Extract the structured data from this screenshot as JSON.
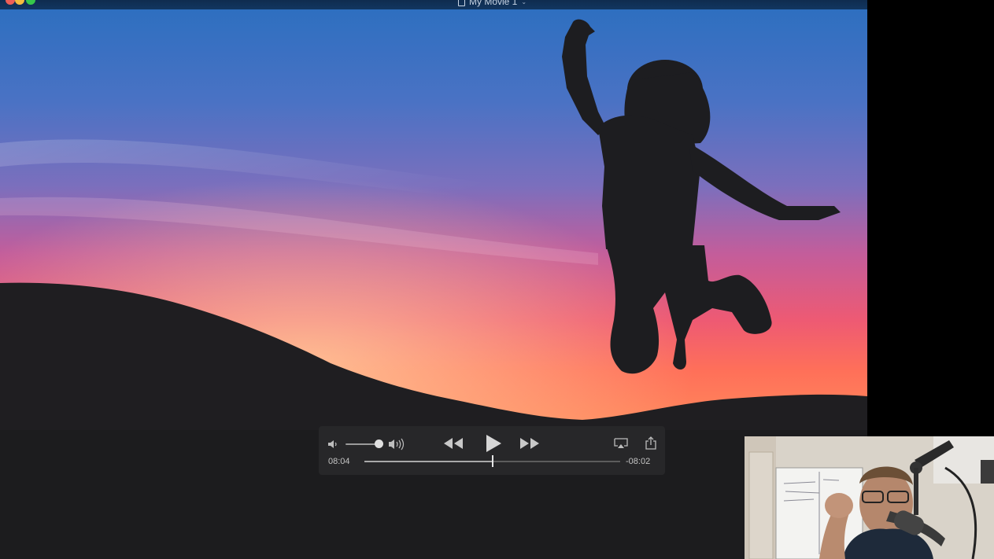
{
  "window": {
    "title": "My Movie 1",
    "traffic_colors": {
      "close": "#ee5f57",
      "minimize": "#f5bd3f",
      "zoom": "#36c84b"
    }
  },
  "player": {
    "elapsed": "08:04",
    "remaining": "-08:02",
    "progress_fraction": 0.5,
    "volume_fraction": 0.95
  },
  "icons": {
    "volume_low": "speaker-low-icon",
    "volume_high": "speaker-high-icon",
    "rewind": "rewind-icon",
    "play": "play-icon",
    "fast_forward": "fast-forward-icon",
    "airplay": "airplay-icon",
    "share": "share-icon"
  }
}
